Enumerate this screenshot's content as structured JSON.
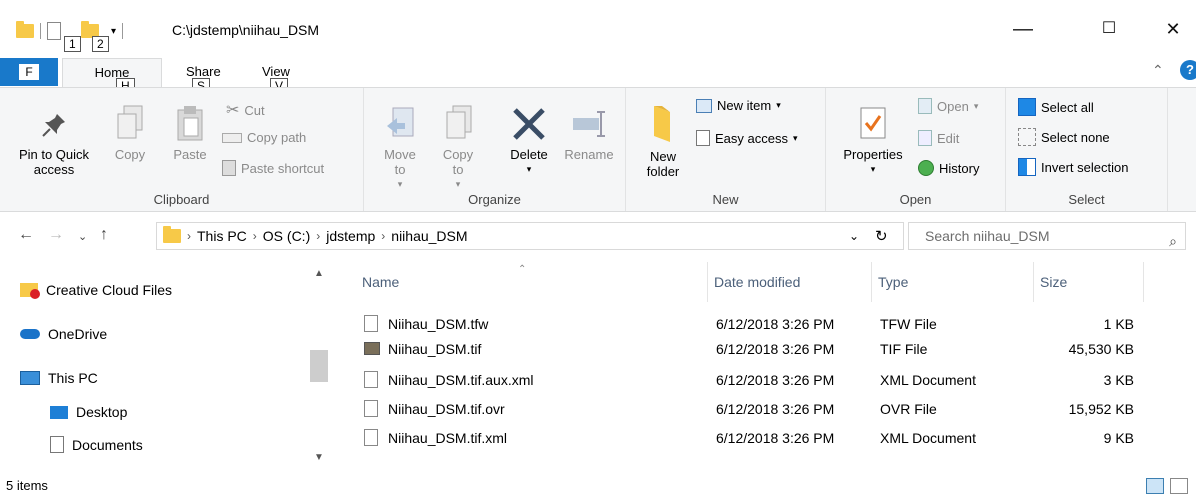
{
  "window": {
    "path": "C:\\jdstemp\\niihau_DSM",
    "minimize": "—",
    "maximize": "☐",
    "close": "✕"
  },
  "keytips": {
    "qat1": "1",
    "qat2": "2",
    "file": "F",
    "home": "H",
    "share": "S",
    "view": "V"
  },
  "tabs": {
    "file": "F",
    "home": "Home",
    "share": "Share",
    "view": "View"
  },
  "ribbon": {
    "clipboard": {
      "label": "Clipboard",
      "pin": "Pin to Quick access",
      "copy": "Copy",
      "paste": "Paste",
      "cut": "Cut",
      "copy_path": "Copy path",
      "paste_shortcut": "Paste shortcut"
    },
    "organize": {
      "label": "Organize",
      "move_to": "Move to",
      "copy_to": "Copy to",
      "delete": "Delete",
      "rename": "Rename"
    },
    "new": {
      "label": "New",
      "new_folder": "New folder",
      "new_item": "New item",
      "easy_access": "Easy access"
    },
    "open": {
      "label": "Open",
      "properties": "Properties",
      "open": "Open",
      "edit": "Edit",
      "history": "History"
    },
    "select": {
      "label": "Select",
      "select_all": "Select all",
      "select_none": "Select none",
      "invert": "Invert selection"
    }
  },
  "address": {
    "crumbs": [
      "This PC",
      "OS (C:)",
      "jdstemp",
      "niihau_DSM"
    ],
    "search_placeholder": "Search niihau_DSM"
  },
  "navpane": {
    "items": [
      "Creative Cloud Files",
      "OneDrive",
      "This PC",
      "Desktop",
      "Documents"
    ]
  },
  "columns": {
    "name": "Name",
    "date": "Date modified",
    "type": "Type",
    "size": "Size"
  },
  "files": [
    {
      "name": "Niihau_DSM.tfw",
      "date": "6/12/2018 3:26 PM",
      "type": "TFW File",
      "size": "1 KB"
    },
    {
      "name": "Niihau_DSM.tif",
      "date": "6/12/2018 3:26 PM",
      "type": "TIF File",
      "size": "45,530 KB"
    },
    {
      "name": "Niihau_DSM.tif.aux.xml",
      "date": "6/12/2018 3:26 PM",
      "type": "XML Document",
      "size": "3 KB"
    },
    {
      "name": "Niihau_DSM.tif.ovr",
      "date": "6/12/2018 3:26 PM",
      "type": "OVR File",
      "size": "15,952 KB"
    },
    {
      "name": "Niihau_DSM.tif.xml",
      "date": "6/12/2018 3:26 PM",
      "type": "XML Document",
      "size": "9 KB"
    }
  ],
  "status": {
    "count": "5 items"
  }
}
